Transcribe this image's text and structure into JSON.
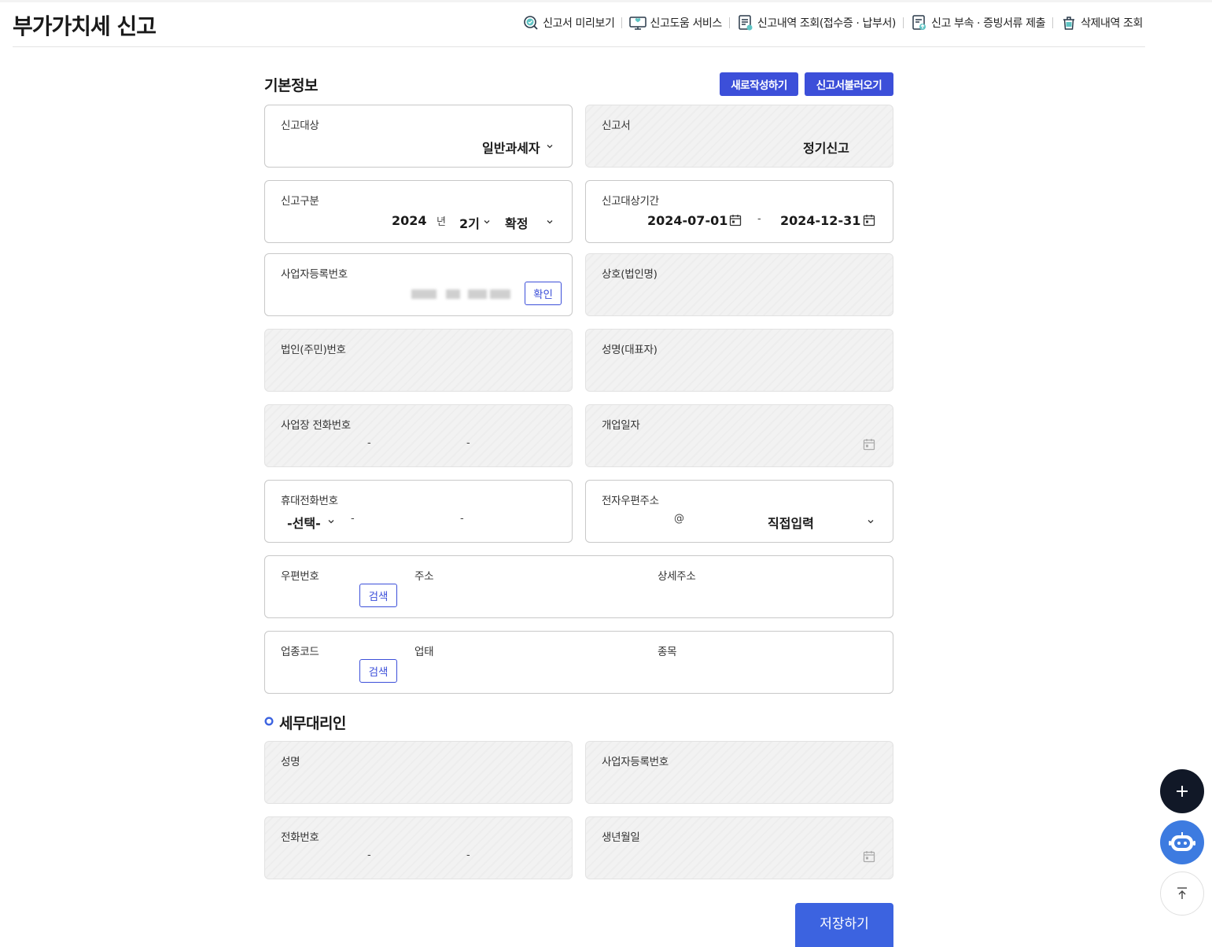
{
  "page": {
    "title": "부가가치세 신고"
  },
  "toplinks": [
    {
      "label": "신고서 미리보기",
      "icon": "search-check-icon"
    },
    {
      "label": "신고도움 서비스",
      "icon": "monitor-heart-icon"
    },
    {
      "label": "신고내역 조회(접수증 · 납부서)",
      "icon": "document-list-icon"
    },
    {
      "label": "신고 부속 · 증빙서류 제출",
      "icon": "document-upload-icon"
    },
    {
      "label": "삭제내역 조회",
      "icon": "trash-icon"
    }
  ],
  "basic": {
    "title": "기본정보",
    "new_button": "새로작성하기",
    "load_button": "신고서불러오기",
    "target": {
      "label": "신고대상",
      "value": "일반과세자"
    },
    "form": {
      "label": "신고서",
      "value": "정기신고"
    },
    "category": {
      "label": "신고구분",
      "year": "2024",
      "year_unit": "년",
      "period": "2기",
      "type": "확정"
    },
    "period_range": {
      "label": "신고대상기간",
      "start": "2024-07-01",
      "dash": "-",
      "end": "2024-12-31"
    },
    "biz_no": {
      "label": "사업자등록번호",
      "confirm": "확인"
    },
    "company": {
      "label": "상호(법인명)"
    },
    "corp_no": {
      "label": "법인(주민)번호"
    },
    "rep_name": {
      "label": "성명(대표자)"
    },
    "biz_phone": {
      "label": "사업장 전화번호",
      "dash1": "-",
      "dash2": "-"
    },
    "open_date": {
      "label": "개업일자"
    },
    "mobile": {
      "label": "휴대전화번호",
      "select": "-선택-",
      "dash1": "-",
      "dash2": "-"
    },
    "email": {
      "label": "전자우편주소",
      "at": "@",
      "domain": "직접입력"
    },
    "address": {
      "zip_label": "우편번호",
      "search": "검색",
      "addr_label": "주소",
      "detail_label": "상세주소"
    },
    "industry": {
      "code_label": "업종코드",
      "search": "검색",
      "type_label": "업태",
      "item_label": "종목"
    }
  },
  "agent": {
    "title": "세무대리인",
    "name": {
      "label": "성명"
    },
    "biz_no": {
      "label": "사업자등록번호"
    },
    "phone": {
      "label": "전화번호",
      "dash1": "-",
      "dash2": "-"
    },
    "birth": {
      "label": "생년월일"
    }
  },
  "save_button": "저장하기",
  "colors": {
    "accent": "#3c4fd9",
    "save": "#3c63e0",
    "fab_dark": "#111827",
    "fab_bot": "#3d7be0"
  }
}
